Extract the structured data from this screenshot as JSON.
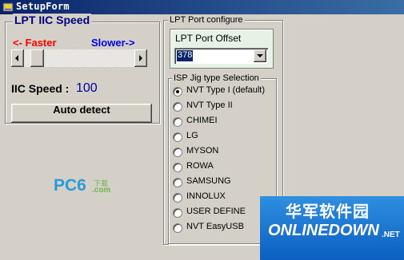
{
  "window": {
    "title": "SetupForm",
    "icon": "app-icon"
  },
  "speed_group": {
    "title": "LPT IIC Speed",
    "faster_label": "<- Faster",
    "slower_label": "Slower->",
    "slider_position": 0.05,
    "iic_speed_label": "IIC Speed :",
    "iic_speed_value": "100",
    "auto_detect_label": "Auto detect"
  },
  "port_group": {
    "title": "LPT Port configure",
    "offset_label": "LPT Port Offset",
    "offset_value": "378"
  },
  "jig_group": {
    "title": "ISP Jig type Selection",
    "options": [
      "NVT Type I (default)",
      "NVT Type II",
      "CHIMEI",
      "LG",
      "MYSON",
      "ROWA",
      "SAMSUNG",
      "INNOLUX",
      "USER DEFINE",
      "NVT EasyUSB"
    ],
    "selected_index": 0
  },
  "watermarks": {
    "pc6_main": "PC6",
    "pc6_sub": "下载",
    "pc6_com": ".com",
    "onlinedown_cn": "华军软件园",
    "onlinedown_en": "ONLINEDOWN",
    "onlinedown_net": ".NET"
  },
  "colors": {
    "titlebar": "#0a246a",
    "faster": "#ff0000",
    "slower": "#0000ff",
    "selection": "#0a246a",
    "offset_panel": "#e6f2e6"
  }
}
